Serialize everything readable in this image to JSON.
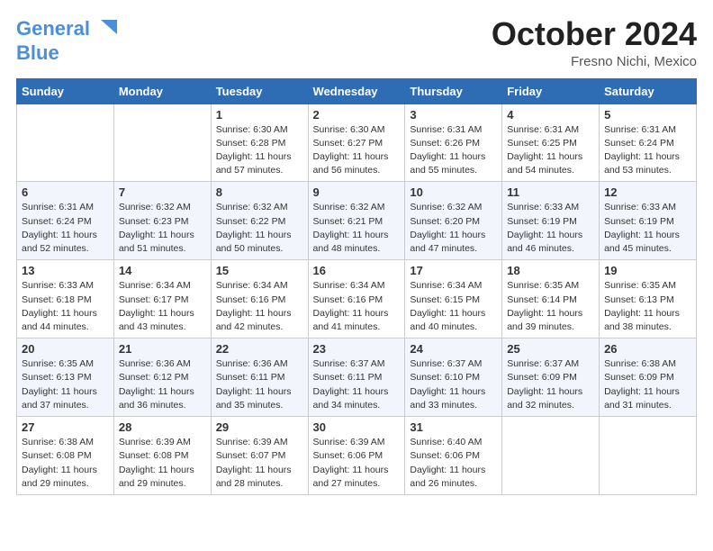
{
  "header": {
    "logo_line1": "General",
    "logo_line2": "Blue",
    "month_title": "October 2024",
    "location": "Fresno Nichi, Mexico"
  },
  "weekdays": [
    "Sunday",
    "Monday",
    "Tuesday",
    "Wednesday",
    "Thursday",
    "Friday",
    "Saturday"
  ],
  "weeks": [
    [
      {
        "day": "",
        "info": ""
      },
      {
        "day": "",
        "info": ""
      },
      {
        "day": "1",
        "info": "Sunrise: 6:30 AM\nSunset: 6:28 PM\nDaylight: 11 hours and 57 minutes."
      },
      {
        "day": "2",
        "info": "Sunrise: 6:30 AM\nSunset: 6:27 PM\nDaylight: 11 hours and 56 minutes."
      },
      {
        "day": "3",
        "info": "Sunrise: 6:31 AM\nSunset: 6:26 PM\nDaylight: 11 hours and 55 minutes."
      },
      {
        "day": "4",
        "info": "Sunrise: 6:31 AM\nSunset: 6:25 PM\nDaylight: 11 hours and 54 minutes."
      },
      {
        "day": "5",
        "info": "Sunrise: 6:31 AM\nSunset: 6:24 PM\nDaylight: 11 hours and 53 minutes."
      }
    ],
    [
      {
        "day": "6",
        "info": "Sunrise: 6:31 AM\nSunset: 6:24 PM\nDaylight: 11 hours and 52 minutes."
      },
      {
        "day": "7",
        "info": "Sunrise: 6:32 AM\nSunset: 6:23 PM\nDaylight: 11 hours and 51 minutes."
      },
      {
        "day": "8",
        "info": "Sunrise: 6:32 AM\nSunset: 6:22 PM\nDaylight: 11 hours and 50 minutes."
      },
      {
        "day": "9",
        "info": "Sunrise: 6:32 AM\nSunset: 6:21 PM\nDaylight: 11 hours and 48 minutes."
      },
      {
        "day": "10",
        "info": "Sunrise: 6:32 AM\nSunset: 6:20 PM\nDaylight: 11 hours and 47 minutes."
      },
      {
        "day": "11",
        "info": "Sunrise: 6:33 AM\nSunset: 6:19 PM\nDaylight: 11 hours and 46 minutes."
      },
      {
        "day": "12",
        "info": "Sunrise: 6:33 AM\nSunset: 6:19 PM\nDaylight: 11 hours and 45 minutes."
      }
    ],
    [
      {
        "day": "13",
        "info": "Sunrise: 6:33 AM\nSunset: 6:18 PM\nDaylight: 11 hours and 44 minutes."
      },
      {
        "day": "14",
        "info": "Sunrise: 6:34 AM\nSunset: 6:17 PM\nDaylight: 11 hours and 43 minutes."
      },
      {
        "day": "15",
        "info": "Sunrise: 6:34 AM\nSunset: 6:16 PM\nDaylight: 11 hours and 42 minutes."
      },
      {
        "day": "16",
        "info": "Sunrise: 6:34 AM\nSunset: 6:16 PM\nDaylight: 11 hours and 41 minutes."
      },
      {
        "day": "17",
        "info": "Sunrise: 6:34 AM\nSunset: 6:15 PM\nDaylight: 11 hours and 40 minutes."
      },
      {
        "day": "18",
        "info": "Sunrise: 6:35 AM\nSunset: 6:14 PM\nDaylight: 11 hours and 39 minutes."
      },
      {
        "day": "19",
        "info": "Sunrise: 6:35 AM\nSunset: 6:13 PM\nDaylight: 11 hours and 38 minutes."
      }
    ],
    [
      {
        "day": "20",
        "info": "Sunrise: 6:35 AM\nSunset: 6:13 PM\nDaylight: 11 hours and 37 minutes."
      },
      {
        "day": "21",
        "info": "Sunrise: 6:36 AM\nSunset: 6:12 PM\nDaylight: 11 hours and 36 minutes."
      },
      {
        "day": "22",
        "info": "Sunrise: 6:36 AM\nSunset: 6:11 PM\nDaylight: 11 hours and 35 minutes."
      },
      {
        "day": "23",
        "info": "Sunrise: 6:37 AM\nSunset: 6:11 PM\nDaylight: 11 hours and 34 minutes."
      },
      {
        "day": "24",
        "info": "Sunrise: 6:37 AM\nSunset: 6:10 PM\nDaylight: 11 hours and 33 minutes."
      },
      {
        "day": "25",
        "info": "Sunrise: 6:37 AM\nSunset: 6:09 PM\nDaylight: 11 hours and 32 minutes."
      },
      {
        "day": "26",
        "info": "Sunrise: 6:38 AM\nSunset: 6:09 PM\nDaylight: 11 hours and 31 minutes."
      }
    ],
    [
      {
        "day": "27",
        "info": "Sunrise: 6:38 AM\nSunset: 6:08 PM\nDaylight: 11 hours and 29 minutes."
      },
      {
        "day": "28",
        "info": "Sunrise: 6:39 AM\nSunset: 6:08 PM\nDaylight: 11 hours and 29 minutes."
      },
      {
        "day": "29",
        "info": "Sunrise: 6:39 AM\nSunset: 6:07 PM\nDaylight: 11 hours and 28 minutes."
      },
      {
        "day": "30",
        "info": "Sunrise: 6:39 AM\nSunset: 6:06 PM\nDaylight: 11 hours and 27 minutes."
      },
      {
        "day": "31",
        "info": "Sunrise: 6:40 AM\nSunset: 6:06 PM\nDaylight: 11 hours and 26 minutes."
      },
      {
        "day": "",
        "info": ""
      },
      {
        "day": "",
        "info": ""
      }
    ]
  ]
}
